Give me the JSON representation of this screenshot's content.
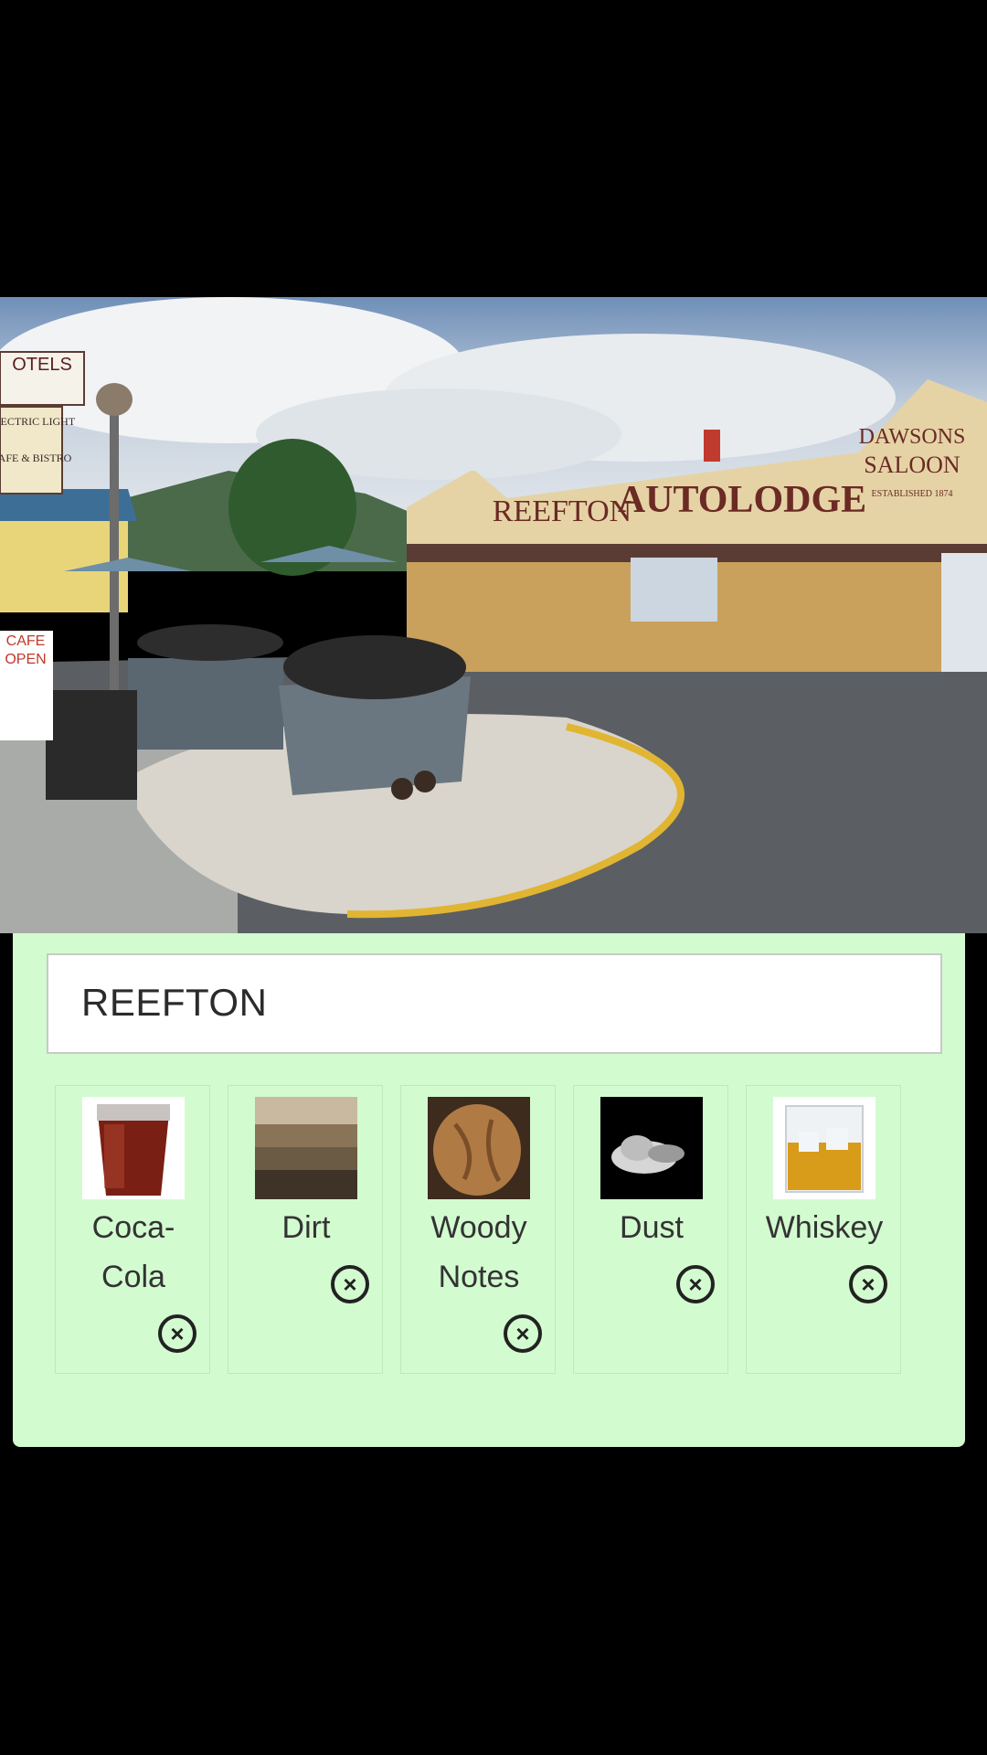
{
  "photo": {
    "signs": {
      "motels": "OTELS",
      "electric_light": "ELECTRIC LIGHT",
      "cafe_bistro": "CAFE & BISTRO",
      "cafe_open_1": "CAFE",
      "cafe_open_2": "OPEN",
      "reefton": "REEFTON",
      "autolodge": "AUTOLODGE",
      "dawsons": "DAWSONS",
      "saloon": "SALOON",
      "established": "ESTABLISHED 1874"
    }
  },
  "search": {
    "value": "REEFTON"
  },
  "cards": [
    {
      "label_line1": "Coca-",
      "label_line2": "Cola",
      "icon": "cola-glass-image"
    },
    {
      "label_line1": "Dirt",
      "label_line2": "",
      "icon": "dirt-image"
    },
    {
      "label_line1": "Woody",
      "label_line2": "Notes",
      "icon": "walnut-image"
    },
    {
      "label_line1": "Dust",
      "label_line2": "",
      "icon": "dust-cloud-image"
    },
    {
      "label_line1": "Whiskey",
      "label_line2": "",
      "icon": "whiskey-glass-image"
    }
  ],
  "remove_glyph": "×",
  "colors": {
    "panel": "#d3fbd0",
    "background": "#000000"
  }
}
